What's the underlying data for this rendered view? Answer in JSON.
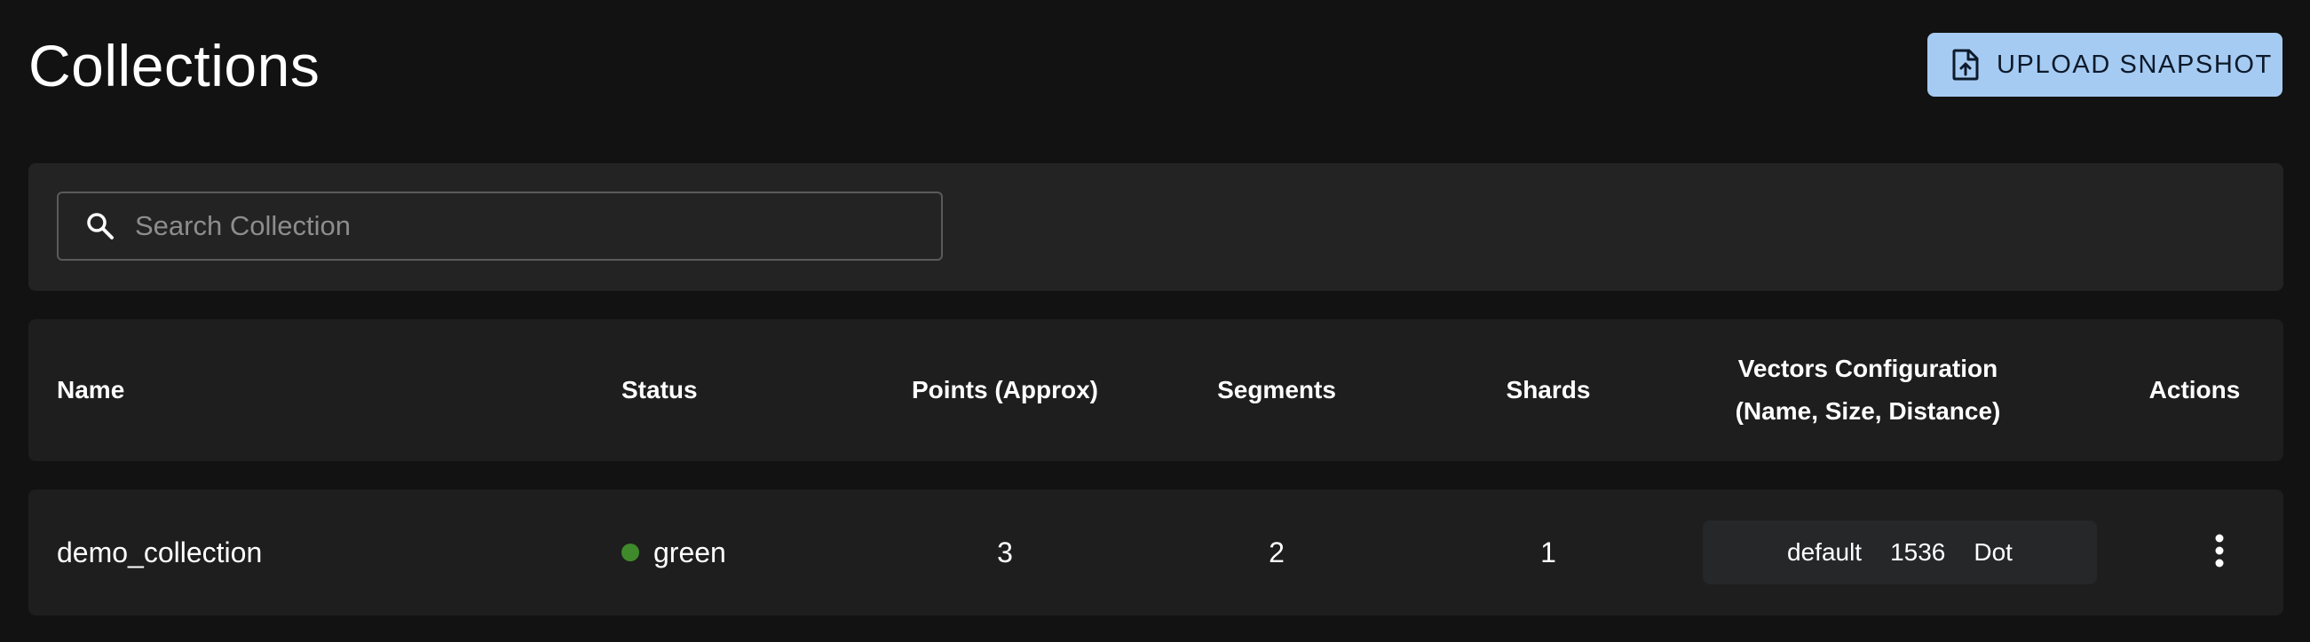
{
  "page": {
    "title": "Collections"
  },
  "toolbar": {
    "upload_label": "UPLOAD SNAPSHOT",
    "upload_icon": "file-upload-icon"
  },
  "search": {
    "placeholder": "Search Collection",
    "value": "",
    "icon": "search-icon"
  },
  "table": {
    "columns": {
      "name": "Name",
      "status": "Status",
      "points": "Points (Approx)",
      "segments": "Segments",
      "shards": "Shards",
      "vectors_line1": "Vectors Configuration",
      "vectors_line2": "(Name, Size, Distance)",
      "actions": "Actions"
    },
    "rows": [
      {
        "name": "demo_collection",
        "status": "green",
        "status_color": "#3f8a2b",
        "points": "3",
        "segments": "2",
        "shards": "1",
        "vector": {
          "name": "default",
          "size": "1536",
          "distance": "Dot"
        },
        "actions_icon": "more-vertical-icon"
      }
    ]
  },
  "colors": {
    "background": "#121212",
    "panel": "#232323",
    "accent": "#a6cbf3"
  }
}
